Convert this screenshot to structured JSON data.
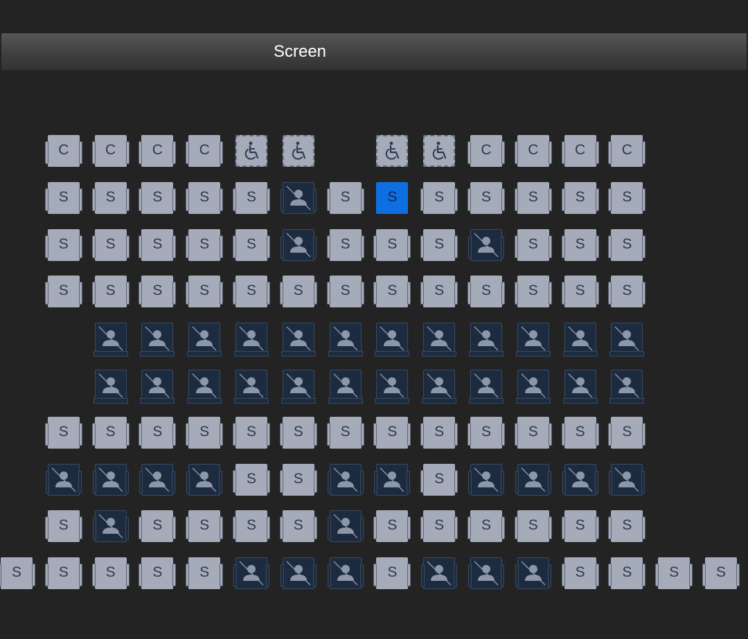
{
  "screen": {
    "label": "Screen"
  },
  "labels": {
    "standard": "S",
    "companion": "C"
  },
  "colors": {
    "background": "#232323",
    "available": "#a5abb8",
    "selected": "#0f6fe0",
    "taken": "#1c2b3f",
    "label_text": "#2c3a52"
  },
  "legend_codes": {
    "S": "standard-available",
    "C": "companion-available",
    "W": "wheelchair-available",
    "X": "unavailable",
    "#": "selected"
  },
  "rows": [
    "_CCCCWW_WWCCCC___",
    "_SSSSSXS#SSSSS___",
    "_SSSSSXSSSXSSS___",
    "_SSSSSSSSSSSSS___",
    "__XXXXXXXXXXXX___",
    "__XXXXXXXXXXXX___",
    "_SSSSSSSSSSSSS___",
    "_XXXXSSXXSXXXX___",
    "_SXSSSSXSSSSSS___",
    "SSSSSXXXSXXXSSSSS"
  ]
}
